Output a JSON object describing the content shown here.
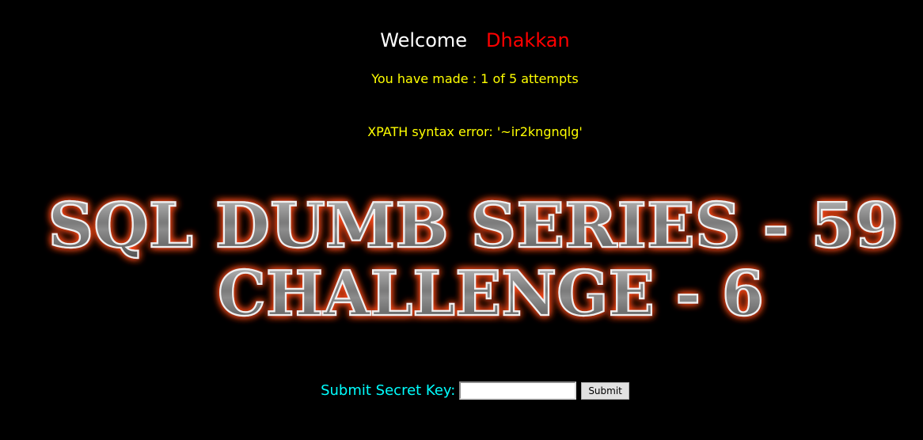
{
  "welcome": {
    "greeting": "Welcome",
    "name": "Dhakkan"
  },
  "status": {
    "attempts_text": "You have made : 1 of 5 attempts",
    "error_text": "XPATH syntax error: '~ir2kngnqlg'"
  },
  "banner": {
    "line1": "SQL DUMB SERIES - 59",
    "line2": "CHALLENGE - 6"
  },
  "form": {
    "label": "Submit Secret Key:",
    "input_value": "",
    "submit_label": "Submit"
  },
  "colors": {
    "background": "#000000",
    "greeting": "#ffffff",
    "name": "#ff0000",
    "status": "#ffff00",
    "label": "#00ffff",
    "banner_glow": "#ff4a1c"
  }
}
